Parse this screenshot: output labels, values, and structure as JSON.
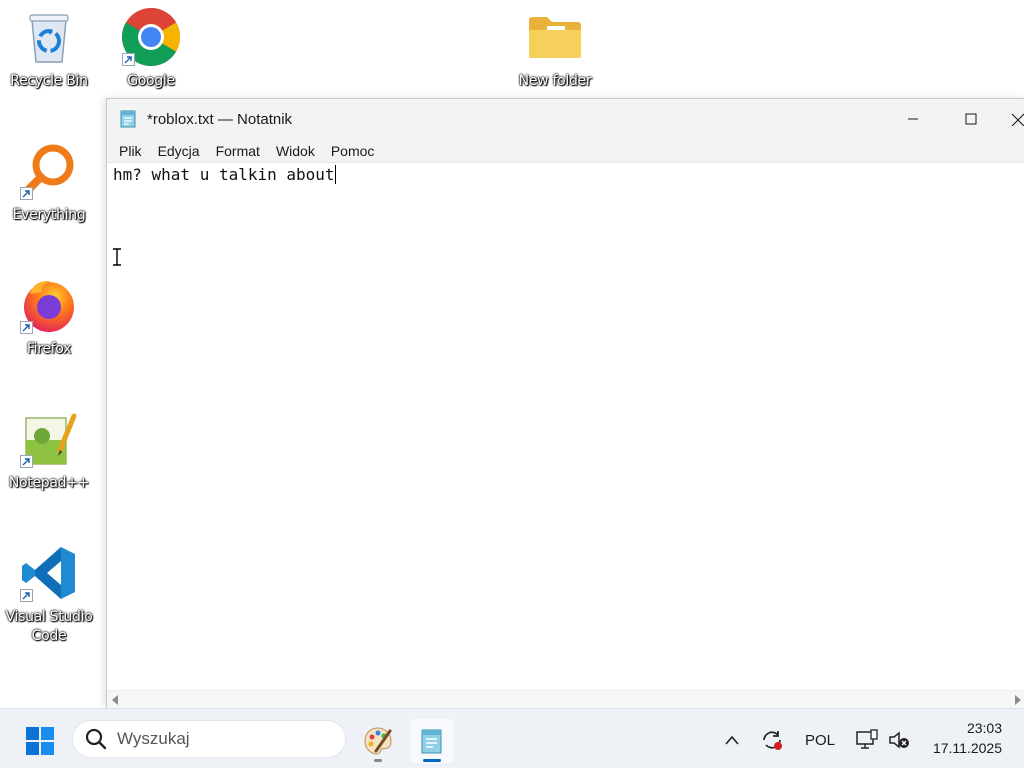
{
  "desktop": {
    "icons": [
      {
        "label": "Recycle Bin"
      },
      {
        "label": "Google Chrome"
      },
      {
        "label": "New folder"
      },
      {
        "label": "Everything"
      },
      {
        "label": "Firefox"
      },
      {
        "label": "Notepad++"
      },
      {
        "label": "Visual Studio Code"
      }
    ]
  },
  "window": {
    "title": "*roblox.txt — Notatnik",
    "menu": [
      "Plik",
      "Edycja",
      "Format",
      "Widok",
      "Pomoc"
    ],
    "content": "hm? what u talkin about"
  },
  "taskbar": {
    "search_placeholder": "Wyszukaj",
    "language": "POL",
    "time": "23:03",
    "date": "17.11.2025"
  },
  "colors": {
    "accent": "#0067c0",
    "taskbar_bg": "#eef2f7"
  }
}
